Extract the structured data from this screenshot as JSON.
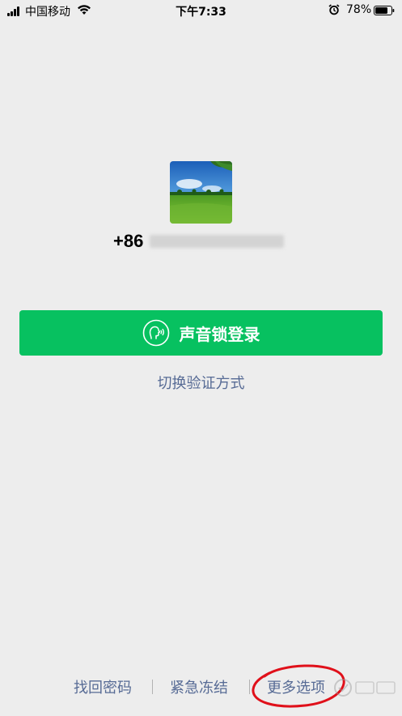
{
  "status_bar": {
    "carrier": "中国移动",
    "time": "下午7:33",
    "battery_percent": "78%",
    "icons": [
      "signal-icon",
      "wifi-icon",
      "alarm-icon",
      "battery-icon"
    ]
  },
  "account": {
    "phone_prefix": "+86",
    "avatar_icon": "landscape-avatar"
  },
  "login": {
    "voice_button_label": "声音锁登录",
    "voice_icon": "voice-lock-icon",
    "switch_method_label": "切换验证方式"
  },
  "footer": {
    "links": [
      "找回密码",
      "紧急冻结",
      "更多选项"
    ]
  },
  "colors": {
    "background": "#EDEDED",
    "primary_green": "#07C160",
    "link_blue": "#576B95",
    "annotation_red": "#E0101A"
  }
}
